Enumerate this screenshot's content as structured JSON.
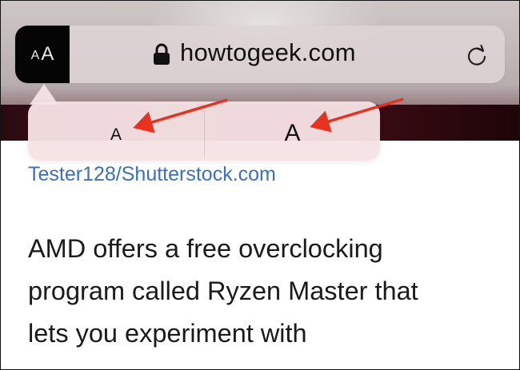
{
  "toolbar": {
    "text_size_button_small": "A",
    "text_size_button_large": "A",
    "domain": "howtogeek.com"
  },
  "icons": {
    "lock": "lock-icon",
    "reload": "reload-icon"
  },
  "text_size_popover": {
    "decrease_label": "A",
    "increase_label": "A"
  },
  "annotations": {
    "arrow_color": "#e8321f"
  },
  "article": {
    "image_credit": "Tester128/Shutterstock.com",
    "paragraph_lines": [
      "AMD offers a free overclocking",
      "program called Ryzen Master that",
      "lets you experiment with"
    ]
  },
  "colors": {
    "link": "#3a6fc4",
    "popover": "#f6e2e4",
    "aa_button": "#050505"
  }
}
